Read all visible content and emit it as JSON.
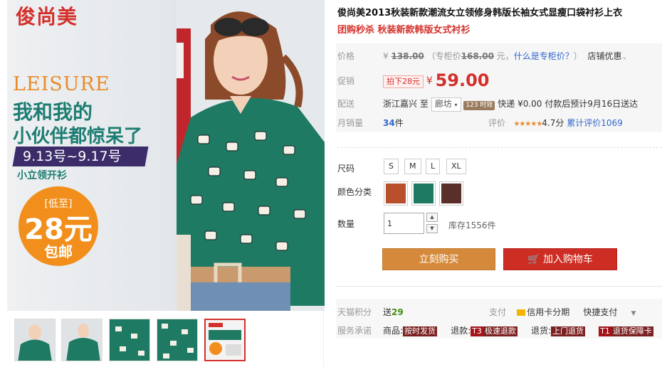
{
  "gallery": {
    "brand_logo": "俊尚美",
    "banner_leisure": "LEISURE",
    "banner_slogan_line1": "我和我的",
    "banner_slogan_line2": "小伙伴都惊呆了",
    "banner_dates": "9.13号~9.17号",
    "banner_collar": "小立领开衫",
    "banner_circle_low": "[低至]",
    "banner_circle_price": "28元",
    "banner_circle_freeship": "包邮",
    "thumbnail_count": 5
  },
  "product": {
    "title": "俊尚美2013秋装新款潮流女立领修身韩版长袖女式显瘦口袋衬衫上衣",
    "subtitle": "团购秒杀 秋装新款韩版女式衬衫"
  },
  "price": {
    "label": "价格",
    "yen": "¥",
    "list_price": "138.00",
    "counter_prefix": "（专柜价",
    "counter_price": "168.00",
    "counter_unit": "元，",
    "what_is_counter": "什么是专柜价？",
    "counter_close": "）",
    "store_promo": "店铺优惠"
  },
  "promo": {
    "label": "促销",
    "tag": "拍下28元",
    "yen": "¥",
    "price": "59.00"
  },
  "shipping": {
    "label": "配送",
    "origin": "浙江嘉兴",
    "to": "至",
    "destination": "廊坊",
    "timely_badge": "123 时效",
    "express": "快递 ¥0.00 付款后预计9月16日送达"
  },
  "sales": {
    "label": "月销量",
    "count": "34",
    "unit": "件",
    "rating_label": "评价",
    "stars": "★★★★★",
    "rating_score": "4.7分",
    "total_reviews": "累计评价1069"
  },
  "sizes": {
    "label": "尺码",
    "options": [
      "S",
      "M",
      "L",
      "XL"
    ]
  },
  "colors": {
    "label": "颜色分类",
    "swatches": [
      "#b8502e",
      "#1f7a63",
      "#5a2f2a"
    ]
  },
  "quantity": {
    "label": "数量",
    "value": "1",
    "stock": "库存1556件"
  },
  "actions": {
    "buy_now": "立刻购买",
    "add_to_cart": "加入购物车"
  },
  "services": {
    "points_label": "天猫积分",
    "points_value_prefix": "送",
    "points_value": "29",
    "pay_label": "支付",
    "pay_credit": "信用卡分期",
    "pay_quick": "快捷支付",
    "promise_label": "服务承诺",
    "promise_goods_prefix": "商品:",
    "promise_goods": "按时发货",
    "promise_refund_prefix": "退款:",
    "promise_refund_badge": "T3",
    "promise_refund": "极速退款",
    "promise_return_prefix": "退货:",
    "promise_return": "上门退货",
    "promise_guarantee_badge": "T1",
    "promise_guarantee": "退货保障卡"
  },
  "colors_theme": {
    "accent_red": "#d4302b",
    "buy_orange": "#d58a3b",
    "cart_red": "#cd2d23",
    "shirt_green": "#1f7a63"
  }
}
